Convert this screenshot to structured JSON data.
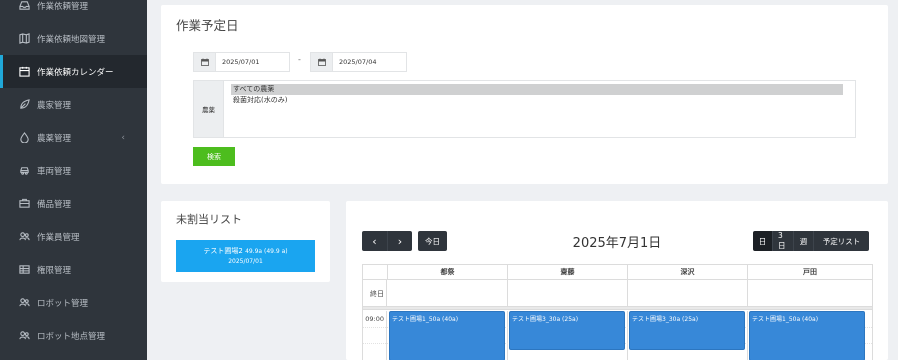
{
  "sidebar": {
    "items": [
      {
        "label": "作業依頼管理",
        "icon": "inbox-icon"
      },
      {
        "label": "作業依頼地図管理",
        "icon": "map-icon"
      },
      {
        "label": "作業依頼カレンダー",
        "icon": "calendar-icon",
        "active": true
      },
      {
        "label": "農家管理",
        "icon": "leaf-icon"
      },
      {
        "label": "農薬管理",
        "icon": "drop-icon",
        "chevron": "‹"
      },
      {
        "label": "車両管理",
        "icon": "car-icon"
      },
      {
        "label": "備品管理",
        "icon": "briefcase-icon"
      },
      {
        "label": "作業員管理",
        "icon": "users-icon"
      },
      {
        "label": "権限管理",
        "icon": "grid-icon"
      },
      {
        "label": "ロボット管理",
        "icon": "robot-icon"
      },
      {
        "label": "ロボット地点管理",
        "icon": "robot-location-icon"
      }
    ]
  },
  "schedule": {
    "title": "作業予定日",
    "date_from": "2025/07/01",
    "date_sep": "-",
    "date_to": "2025/07/04",
    "crop_label": "農薬",
    "crop_options": [
      "すべての農薬",
      "殺菌対応(水のみ)"
    ],
    "search_label": "検索"
  },
  "unassigned": {
    "title": "未割当リスト",
    "item_name": "テスト圃場2",
    "item_area": "49.9a (49.9 a)",
    "item_date": "2025/07/01"
  },
  "calendar": {
    "prev": "‹",
    "next": "›",
    "today": "今日",
    "title": "2025年7月1日",
    "views": [
      "日",
      "3日",
      "週",
      "予定リスト"
    ],
    "active_view": "日",
    "columns": [
      "都祭",
      "齋藤",
      "深沢",
      "戸田"
    ],
    "allday_label": "終日",
    "time_label": "09:00",
    "events": [
      "テスト圃場1_50a (40a)",
      "テスト圃場3_30a (25a)",
      "テスト圃場3_30a (25a)",
      "テスト圃場1_50a (40a)"
    ]
  },
  "colors": {
    "sidebar_bg": "#2f353c",
    "active_accent": "#20a8d8",
    "search_button": "#4dbd1e",
    "unassigned_bg": "#1aa5f0",
    "event_bg": "#3788d8"
  }
}
